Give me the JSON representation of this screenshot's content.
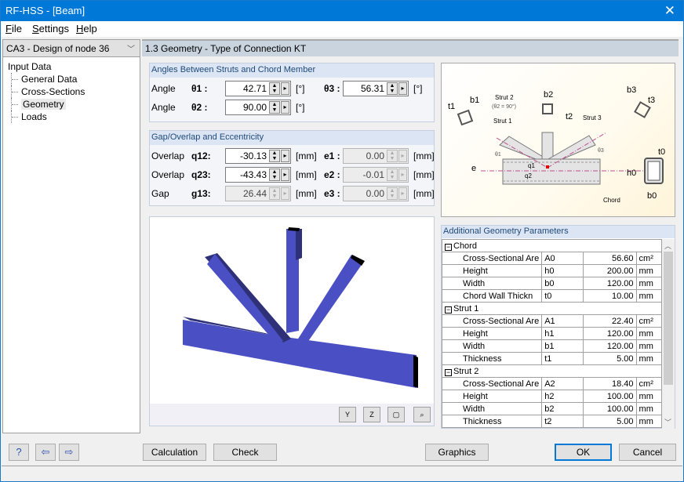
{
  "window": {
    "title": "RF-HSS - [Beam]",
    "close_icon": "close-icon"
  },
  "menu": [
    {
      "label": "File",
      "accel": "F",
      "rest": "ile"
    },
    {
      "label": "Settings",
      "accel": "S",
      "rest": "ettings"
    },
    {
      "label": "Help",
      "accel": "H",
      "rest": "elp"
    }
  ],
  "case_selector": {
    "value": "CA3 - Design of node 36"
  },
  "tree": {
    "root": "Input Data",
    "items": [
      "General Data",
      "Cross-Sections",
      "Geometry",
      "Loads"
    ],
    "selected": "Geometry"
  },
  "header": {
    "title": "1.3 Geometry - Type of Connection KT"
  },
  "angles": {
    "title": "Angles Between Struts and Chord Member",
    "rows": [
      {
        "label": "Angle",
        "symbol": "θ1 :",
        "value": "42.71",
        "unit": "[°]",
        "editable": true
      },
      {
        "label": "Angle",
        "symbol": "θ2 :",
        "value": "90.00",
        "unit": "[°]",
        "editable": true
      },
      {
        "symbol": "θ3 :",
        "value": "56.31",
        "unit": "[°]",
        "editable": true
      }
    ]
  },
  "gap": {
    "title": "Gap/Overlap and Eccentricity",
    "rows": [
      {
        "label": "Overlap",
        "symbol": "q12:",
        "value": "-30.13",
        "unit": "[mm]",
        "editable": true,
        "e_symbol": "e1 :",
        "e_value": "0.00",
        "e_unit": "[mm]"
      },
      {
        "label": "Overlap",
        "symbol": "q23:",
        "value": "-43.43",
        "unit": "[mm]",
        "editable": true,
        "e_symbol": "e2 :",
        "e_value": "-0.01",
        "e_unit": "[mm]"
      },
      {
        "label": "Gap",
        "symbol": "g13:",
        "value": "26.44",
        "unit": "[mm]",
        "editable": false,
        "e_symbol": "e3 :",
        "e_value": "0.00",
        "e_unit": "[mm]"
      }
    ]
  },
  "diagram": {
    "labels": {
      "strut1": "Strut 1",
      "strut2": "Strut 2",
      "strut2_note": "(θ2 = 90°)",
      "strut3": "Strut 3",
      "chord": "Chord",
      "b1": "b1",
      "t1": "t1",
      "b2": "b2",
      "t2": "t2",
      "b3": "b3",
      "t3": "t3",
      "h0": "h0",
      "b0": "b0",
      "t0": "t0",
      "e": "e",
      "q1": "q1",
      "q2": "q2",
      "theta1": "θ1",
      "theta3": "θ3"
    }
  },
  "view3d": {
    "tools": [
      {
        "name": "view-y-icon",
        "label": "Y"
      },
      {
        "name": "view-z-icon",
        "label": "Z"
      },
      {
        "name": "iso-view-icon",
        "label": "▢"
      },
      {
        "name": "reset-view-icon",
        "label": "⌕"
      }
    ],
    "member_color": "#4b4fc4"
  },
  "params": {
    "title": "Additional Geometry Parameters",
    "sections": [
      {
        "name": "Chord",
        "rows": [
          {
            "name": "Cross-Sectional Are",
            "symbol": "A0",
            "value": "56.60",
            "unit": "cm²"
          },
          {
            "name": "Height",
            "symbol": "h0",
            "value": "200.00",
            "unit": "mm"
          },
          {
            "name": "Width",
            "symbol": "b0",
            "value": "120.00",
            "unit": "mm"
          },
          {
            "name": "Chord Wall Thickn",
            "symbol": "t0",
            "value": "10.00",
            "unit": "mm"
          }
        ]
      },
      {
        "name": "Strut 1",
        "rows": [
          {
            "name": "Cross-Sectional Are",
            "symbol": "A1",
            "value": "22.40",
            "unit": "cm²"
          },
          {
            "name": "Height",
            "symbol": "h1",
            "value": "120.00",
            "unit": "mm"
          },
          {
            "name": "Width",
            "symbol": "b1",
            "value": "120.00",
            "unit": "mm"
          },
          {
            "name": "Thickness",
            "symbol": "t1",
            "value": "5.00",
            "unit": "mm"
          }
        ]
      },
      {
        "name": "Strut 2",
        "rows": [
          {
            "name": "Cross-Sectional Are",
            "symbol": "A2",
            "value": "18.40",
            "unit": "cm²"
          },
          {
            "name": "Height",
            "symbol": "h2",
            "value": "100.00",
            "unit": "mm"
          },
          {
            "name": "Width",
            "symbol": "b2",
            "value": "100.00",
            "unit": "mm"
          },
          {
            "name": "Thickness",
            "symbol": "t2",
            "value": "5.00",
            "unit": "mm"
          }
        ]
      }
    ]
  },
  "footer": {
    "calculation": "Calculation",
    "check": "Check",
    "graphics": "Graphics",
    "ok": "OK",
    "cancel": "Cancel"
  }
}
